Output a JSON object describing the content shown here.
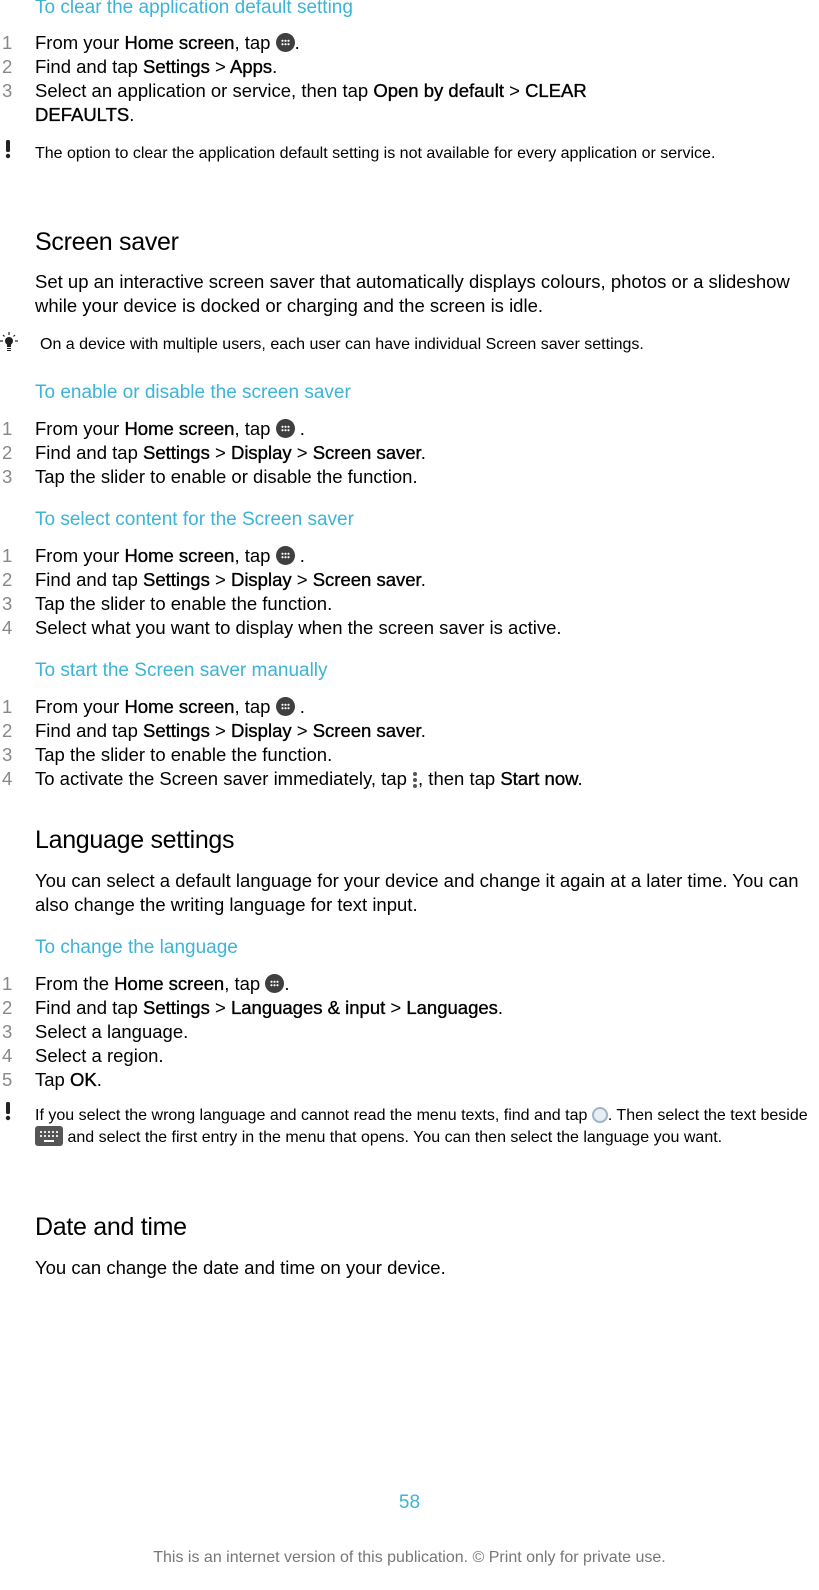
{
  "sections": {
    "clear_default": {
      "title": "To clear the application default setting",
      "steps": [
        {
          "num": "1",
          "pre": "From your ",
          "b1": "Home screen",
          "mid": ", tap ",
          "post": "."
        },
        {
          "num": "2",
          "pre": "Find and tap ",
          "b1": "Settings",
          "sep": " > ",
          "b2": "Apps",
          "post": "."
        },
        {
          "num": "3",
          "pre": "Select an application or service, then tap ",
          "b1": "Open by default",
          "sep": " > ",
          "b2": "CLEAR",
          "line2": "DEFAULTS",
          "post": "."
        }
      ],
      "note": "The option to clear the application default setting is not available for every application or service.",
      "note_icon": "exclamation-icon"
    },
    "screen_saver": {
      "heading": "Screen saver",
      "intro": "Set up an interactive screen saver that automatically displays colours, photos or a slideshow while your device is docked or charging and the screen is idle.",
      "tip": "On a device with multiple users, each user can have individual Screen saver settings.",
      "tip_icon": "lightbulb-icon",
      "enable": {
        "title": "To enable or disable the screen saver",
        "steps": [
          {
            "num": "1",
            "pre": "From your ",
            "b1": "Home screen",
            "mid": ", tap ",
            "post": " ."
          },
          {
            "num": "2",
            "pre": "Find and tap ",
            "b1": "Settings",
            "sep1": " > ",
            "b2": "Display",
            "sep2": " > ",
            "b3": "Screen saver",
            "post": "."
          },
          {
            "num": "3",
            "text": "Tap the slider to enable or disable the function."
          }
        ]
      },
      "select_content": {
        "title": "To select content for the Screen saver",
        "steps": [
          {
            "num": "1",
            "pre": "From your ",
            "b1": "Home screen",
            "mid": ", tap ",
            "post": " ."
          },
          {
            "num": "2",
            "pre": "Find and tap ",
            "b1": "Settings",
            "sep1": " > ",
            "b2": "Display",
            "sep2": " > ",
            "b3": "Screen saver",
            "post": "."
          },
          {
            "num": "3",
            "text": "Tap the slider to enable the function."
          },
          {
            "num": "4",
            "text": "Select what you want to display when the screen saver is active."
          }
        ]
      },
      "start_manually": {
        "title": "To start the Screen saver manually",
        "steps": [
          {
            "num": "1",
            "pre": "From your ",
            "b1": "Home screen",
            "mid": ", tap ",
            "post": " ."
          },
          {
            "num": "2",
            "pre": "Find and tap ",
            "b1": "Settings",
            "sep1": " > ",
            "b2": "Display",
            "sep2": " > ",
            "b3": "Screen saver",
            "post": "."
          },
          {
            "num": "3",
            "text": "Tap the slider to enable the function."
          },
          {
            "num": "4",
            "pre": "To activate the Screen saver immediately, tap ",
            "mid": ", then tap ",
            "b1": "Start now",
            "post": "."
          }
        ]
      }
    },
    "language": {
      "heading": "Language settings",
      "intro": "You can select a default language for your device and change it again at a later time. You can also change the writing language for text input.",
      "change": {
        "title": "To change the language",
        "steps": [
          {
            "num": "1",
            "pre": "From the ",
            "b1": "Home screen",
            "mid": ", tap ",
            "post": "."
          },
          {
            "num": "2",
            "pre": "Find and tap ",
            "b1": "Settings",
            "sep1": " > ",
            "b2": "Languages & input",
            "sep2": " > ",
            "b3": "Languages",
            "post": "."
          },
          {
            "num": "3",
            "text": "Select a language."
          },
          {
            "num": "4",
            "text": "Select a region."
          },
          {
            "num": "5",
            "pre": "Tap ",
            "b1": "OK",
            "post": "."
          }
        ]
      },
      "note_parts": {
        "a": "If you select the wrong language and cannot read the menu texts, find and tap ",
        "b": ". Then select the text beside ",
        "c": " and select the first entry in the menu that opens. You can then select the language you want."
      },
      "note_icon": "exclamation-icon"
    },
    "date_time": {
      "heading": "Date and time",
      "intro": "You can change the date and time on your device."
    }
  },
  "footer": {
    "page_number": "58",
    "notice": "This is an internet version of this publication. © Print only for private use."
  },
  "colors": {
    "accent": "#3cb4d6",
    "step_number": "#888888",
    "text": "#000000",
    "footer_text": "#777777"
  }
}
